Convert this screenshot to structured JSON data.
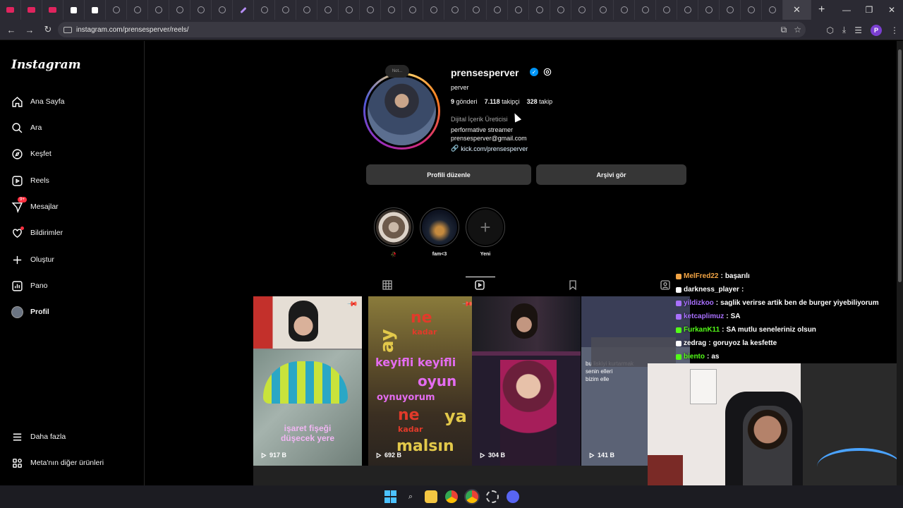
{
  "browser": {
    "url": "instagram.com/prensesperver/reels/",
    "tab_count": 37,
    "profile_initial": "P"
  },
  "sidebar": {
    "logo": "Instagram",
    "items": [
      {
        "label": "Ana Sayfa",
        "icon": "home-icon"
      },
      {
        "label": "Ara",
        "icon": "search-icon"
      },
      {
        "label": "Keşfet",
        "icon": "compass-icon"
      },
      {
        "label": "Reels",
        "icon": "reels-icon"
      },
      {
        "label": "Mesajlar",
        "icon": "messenger-icon",
        "badge": "9+"
      },
      {
        "label": "Bildirimler",
        "icon": "heart-icon"
      },
      {
        "label": "Oluştur",
        "icon": "plus-icon"
      },
      {
        "label": "Pano",
        "icon": "dashboard-icon"
      },
      {
        "label": "Profil",
        "icon": "avatar"
      }
    ],
    "more": "Daha fazla",
    "meta": "Meta'nın diğer ürünleri"
  },
  "profile": {
    "note": "Not...",
    "username": "prensesperver",
    "full_name": "perver",
    "posts": "9",
    "posts_label": "gönderi",
    "followers": "7.118",
    "followers_label": "takipçi",
    "following": "328",
    "following_label": "takip",
    "category": "Dijital İçerik Üreticisi",
    "bio_line1": "performative streamer",
    "bio_line2": "prensesperver@gmail.com",
    "link": "kick.com/prensesperver",
    "edit_button": "Profili düzenle",
    "archive_button": "Arşivi gör"
  },
  "highlights": [
    {
      "label": "🥀"
    },
    {
      "label": "fam<3"
    },
    {
      "label": "Yeni"
    }
  ],
  "reels": [
    {
      "views": "917 B",
      "pinned": true,
      "caption": "işaret fişeği düşecek yere"
    },
    {
      "views": "692 B",
      "pinned": true,
      "caption": "ay ne kadar keyifli keyifli oyun oynuyorum ya ne kadar malsın"
    },
    {
      "views": "304 B",
      "pinned": false,
      "caption": ""
    },
    {
      "views": "141 B",
      "pinned": false,
      "caption": "bu liskiyi kurtarmak senin elleri bizim elle"
    }
  ],
  "chat": [
    {
      "user": "MelFred22",
      "msg": "başarılı",
      "color": "#f2a444"
    },
    {
      "user": "darkness_player",
      "msg": "",
      "color": "#ffffff"
    },
    {
      "user": "yildizkoo",
      "msg": "saglik verirse artik ben de burger yiyebiliyorum",
      "color": "#a970ff"
    },
    {
      "user": "ketcaplimuz",
      "msg": "SA",
      "color": "#a970ff"
    },
    {
      "user": "FurkanK11",
      "msg": "SA  mutlu seneleriniz olsun",
      "color": "#53fc18"
    },
    {
      "user": "zedrag",
      "msg": "goruyoz la kesfette",
      "color": "#ffffff"
    },
    {
      "user": "biento",
      "msg": "as",
      "color": "#53fc18"
    }
  ]
}
